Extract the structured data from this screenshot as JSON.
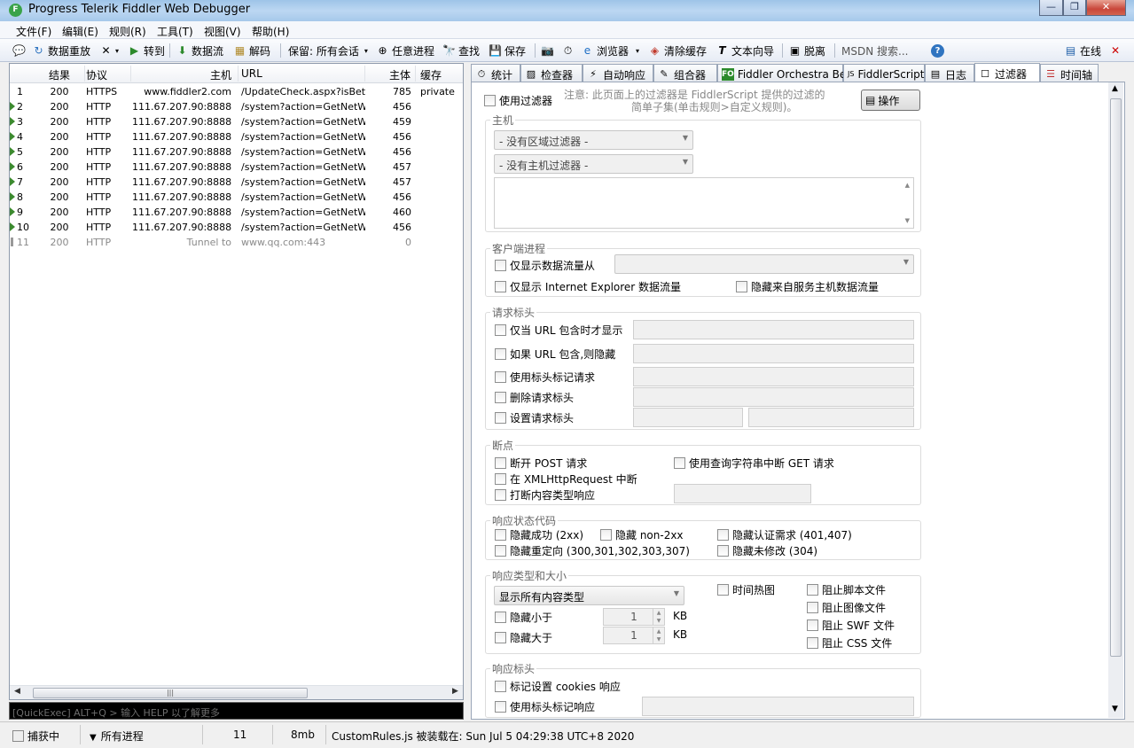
{
  "window": {
    "title": "Progress Telerik Fiddler Web Debugger"
  },
  "menu": [
    "文件(F)",
    "编辑(E)",
    "规则(R)",
    "工具(T)",
    "视图(V)",
    "帮助(H)"
  ],
  "toolbar": {
    "replay": "数据重放",
    "go": "转到",
    "stream": "数据流",
    "decode": "解码",
    "keep": "保留: 所有会话",
    "any_process": "任意进程",
    "find": "查找",
    "save": "保存",
    "browse": "浏览器",
    "clear_cache": "清除缓存",
    "text_wizard": "文本向导",
    "tearoff": "脱离",
    "msdn_search": "MSDN 搜索...",
    "online": "在线"
  },
  "sessions": {
    "columns": [
      "结果",
      "协议",
      "主机",
      "URL",
      "主体",
      "缓存"
    ],
    "rows": [
      {
        "id": "1",
        "result": "200",
        "protocol": "HTTPS",
        "host": "www.fiddler2.com",
        "url": "/UpdateCheck.aspx?isBet...",
        "body": "785",
        "caching": "private"
      },
      {
        "id": "2",
        "result": "200",
        "protocol": "HTTP",
        "host": "111.67.207.90:8888",
        "url": "/system?action=GetNetW...",
        "body": "456",
        "caching": ""
      },
      {
        "id": "3",
        "result": "200",
        "protocol": "HTTP",
        "host": "111.67.207.90:8888",
        "url": "/system?action=GetNetW...",
        "body": "459",
        "caching": ""
      },
      {
        "id": "4",
        "result": "200",
        "protocol": "HTTP",
        "host": "111.67.207.90:8888",
        "url": "/system?action=GetNetW...",
        "body": "456",
        "caching": ""
      },
      {
        "id": "5",
        "result": "200",
        "protocol": "HTTP",
        "host": "111.67.207.90:8888",
        "url": "/system?action=GetNetW...",
        "body": "456",
        "caching": ""
      },
      {
        "id": "6",
        "result": "200",
        "protocol": "HTTP",
        "host": "111.67.207.90:8888",
        "url": "/system?action=GetNetW...",
        "body": "457",
        "caching": ""
      },
      {
        "id": "7",
        "result": "200",
        "protocol": "HTTP",
        "host": "111.67.207.90:8888",
        "url": "/system?action=GetNetW...",
        "body": "457",
        "caching": ""
      },
      {
        "id": "8",
        "result": "200",
        "protocol": "HTTP",
        "host": "111.67.207.90:8888",
        "url": "/system?action=GetNetW...",
        "body": "456",
        "caching": ""
      },
      {
        "id": "9",
        "result": "200",
        "protocol": "HTTP",
        "host": "111.67.207.90:8888",
        "url": "/system?action=GetNetW...",
        "body": "460",
        "caching": ""
      },
      {
        "id": "10",
        "result": "200",
        "protocol": "HTTP",
        "host": "111.67.207.90:8888",
        "url": "/system?action=GetNetW...",
        "body": "456",
        "caching": ""
      },
      {
        "id": "11",
        "result": "200",
        "protocol": "HTTP",
        "host": "Tunnel to",
        "url": "www.qq.com:443",
        "body": "0",
        "caching": ""
      }
    ]
  },
  "quickexec": "[QuickExec] ALT+Q > 输入 HELP 以了解更多",
  "tabs": [
    "统计",
    "检查器",
    "自动响应",
    "组合器",
    "Fiddler Orchestra Beta",
    "FiddlerScript",
    "日志",
    "过滤器",
    "时间轴"
  ],
  "filters": {
    "use_filters": "使用过滤器",
    "note_line1": "注意: 此页面上的过滤器是 FiddlerScript 提供的过滤的",
    "note_line2": "简单子集(单击规则>自定义规则)。",
    "actions_button": "操作",
    "hosts": {
      "title": "主机",
      "zone_filter": "- 没有区域过滤器 -",
      "host_filter": "- 没有主机过滤器 -"
    },
    "client_process": {
      "title": "客户端进程",
      "show_only_from": "仅显示数据流量从",
      "show_only_ie": "仅显示 Internet Explorer 数据流量",
      "hide_service_host": "隐藏来自服务主机数据流量"
    },
    "request_headers": {
      "title": "请求标头",
      "show_if_url_contains": "仅当 URL 包含时才显示",
      "hide_if_url_contains": "如果 URL 包含,则隐藏",
      "flag_with_header": "使用标头标记请求",
      "delete_header": "删除请求标头",
      "set_header": "设置请求标头"
    },
    "breakpoints": {
      "title": "断点",
      "break_post": "断开 POST 请求",
      "break_get_querystring": "使用查询字符串中断 GET 请求",
      "break_xhr": "在 XMLHttpRequest 中断",
      "break_content_type": "打断内容类型响应"
    },
    "response_status": {
      "title": "响应状态代码",
      "hide_success": "隐藏成功 (2xx)",
      "hide_non2xx": "隐藏 non-2xx",
      "hide_auth": "隐藏认证需求 (401,407)",
      "hide_redirects": "隐藏重定向 (300,301,302,303,307)",
      "hide_not_modified": "隐藏未修改 (304)"
    },
    "response_type_size": {
      "title": "响应类型和大小",
      "content_types": "显示所有内容类型",
      "time_heatmap": "时间热图",
      "block_script": "阻止脚本文件",
      "block_image": "阻止图像文件",
      "block_swf": "阻止 SWF 文件",
      "block_css": "阻止 CSS 文件",
      "hide_smaller": "隐藏小于",
      "hide_larger": "隐藏大于",
      "smaller_value": "1",
      "larger_value": "1",
      "unit": "KB"
    },
    "response_headers": {
      "title": "响应标头",
      "flag_cookies": "标记设置 cookies 响应",
      "flag_with_header": "使用标头标记响应"
    }
  },
  "statusbar": {
    "capturing": "捕获中",
    "process": "所有进程",
    "count": "11",
    "memory": "8mb",
    "message": "CustomRules.js 被装载在: Sun Jul 5 04:29:38 UTC+8 2020"
  }
}
